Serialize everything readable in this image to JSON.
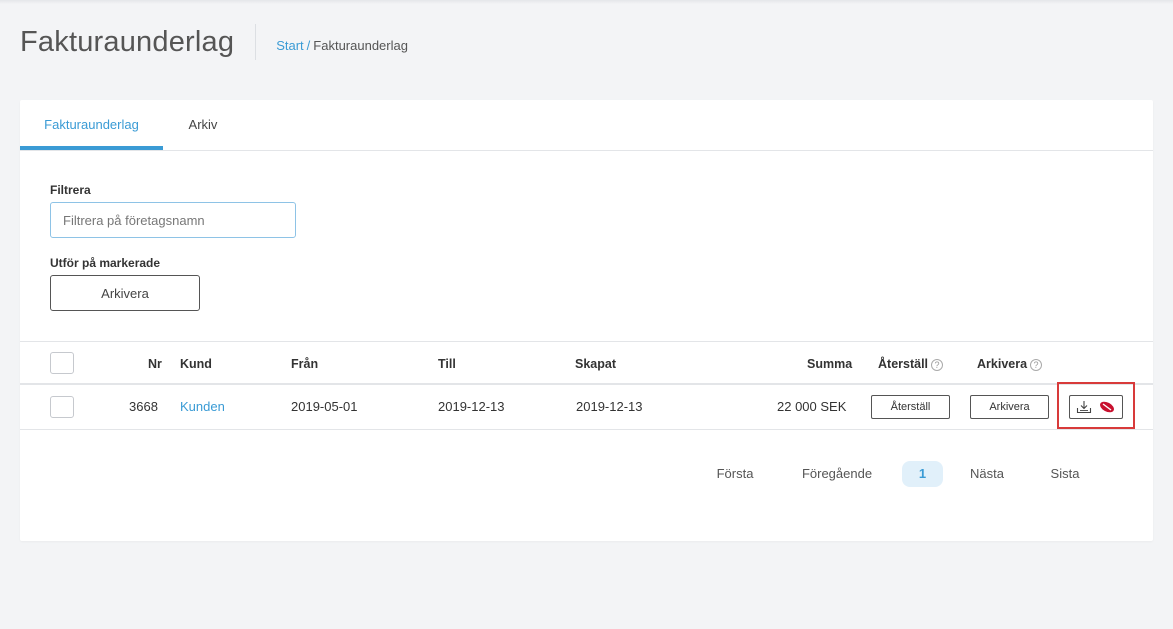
{
  "header": {
    "title": "Fakturaunderlag",
    "breadcrumb": {
      "home": "Start",
      "separator": "/",
      "current": "Fakturaunderlag"
    }
  },
  "tabs": [
    {
      "label": "Fakturaunderlag",
      "active": true
    },
    {
      "label": "Arkiv",
      "active": false
    }
  ],
  "filter": {
    "label": "Filtrera",
    "placeholder": "Filtrera på företagsnamn",
    "value": ""
  },
  "bulk": {
    "label": "Utför på markerade",
    "archive_button": "Arkivera"
  },
  "table": {
    "columns": {
      "nr": "Nr",
      "kund": "Kund",
      "fran": "Från",
      "till": "Till",
      "skapat": "Skapat",
      "summa": "Summa",
      "aterstall": "Återställ",
      "arkivera": "Arkivera",
      "help_glyph": "?"
    },
    "rows": [
      {
        "nr": "3668",
        "kund": "Kunden",
        "fran": "2019-05-01",
        "till": "2019-12-13",
        "skapat": "2019-12-13",
        "summa": "22 000 SEK",
        "restore_button": "Återställ",
        "archive_button": "Arkivera",
        "icons": [
          "download-icon",
          "visma-logo-icon"
        ]
      }
    ]
  },
  "pagination": {
    "first": "Första",
    "previous": "Föregående",
    "current": "1",
    "next": "Nästa",
    "last": "Sista"
  },
  "colors": {
    "accent": "#3a9bd5",
    "highlight": "#d83a3a",
    "logo": "#c8102e"
  }
}
